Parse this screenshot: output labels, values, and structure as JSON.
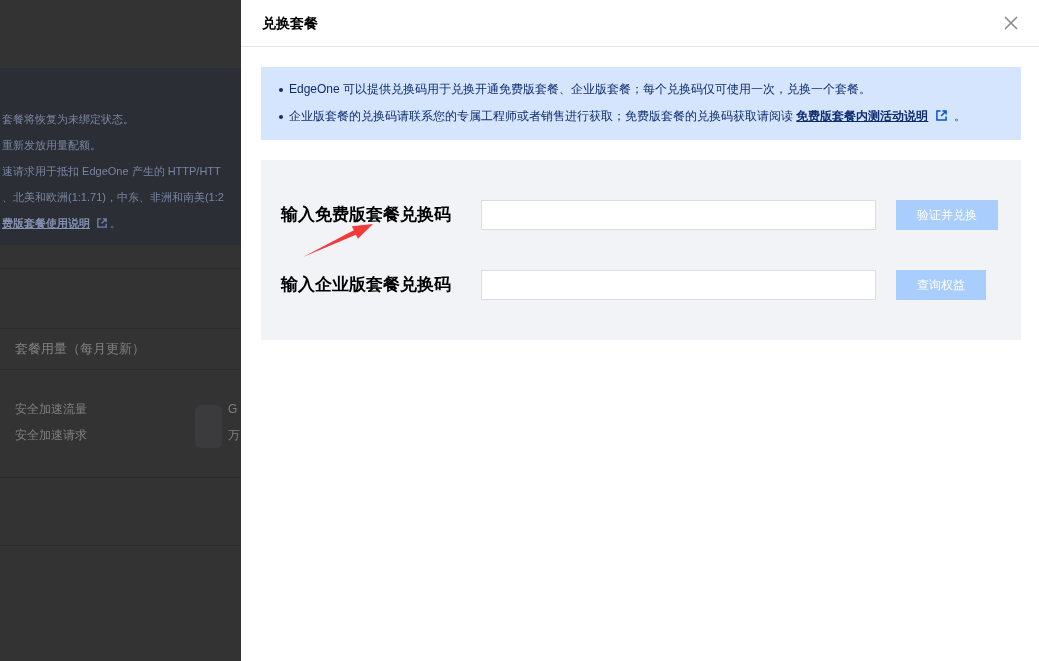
{
  "background_page": {
    "notice_lines": [
      {
        "text": "套餐将恢复为未绑定状态。"
      },
      {
        "text": "重新发放用量配额。"
      },
      {
        "text": "速请求用于抵扣 EdgeOne 产生的 HTTP/HTT"
      },
      {
        "text": "、北美和欧洲(1:1.71)，中东、非洲和南美(1:2"
      },
      {
        "link": "费版套餐使用说明",
        "suffix": "。"
      }
    ],
    "usage_card": {
      "title": "套餐用量（每月更新）",
      "rows": [
        {
          "label": "安全加速流量",
          "value": "G"
        },
        {
          "label": "安全加速请求",
          "value": "万"
        }
      ]
    }
  },
  "drawer": {
    "title": "兑换套餐",
    "notices": [
      {
        "text": "EdgeOne 可以提供兑换码用于兑换开通免费版套餐、企业版套餐；每个兑换码仅可使用一次，兑换一个套餐。"
      },
      {
        "text": "企业版套餐的兑换码请联系您的专属工程师或者销售进行获取；免费版套餐的兑换码获取请阅读 ",
        "link": "免费版套餐内测活动说明",
        "suffix": " 。"
      }
    ],
    "fields": [
      {
        "label": "输入免费版套餐兑换码",
        "button": "验证并兑换",
        "disabled": true
      },
      {
        "label": "输入企业版套餐兑换码",
        "button": "查询权益",
        "disabled": true
      }
    ]
  }
}
